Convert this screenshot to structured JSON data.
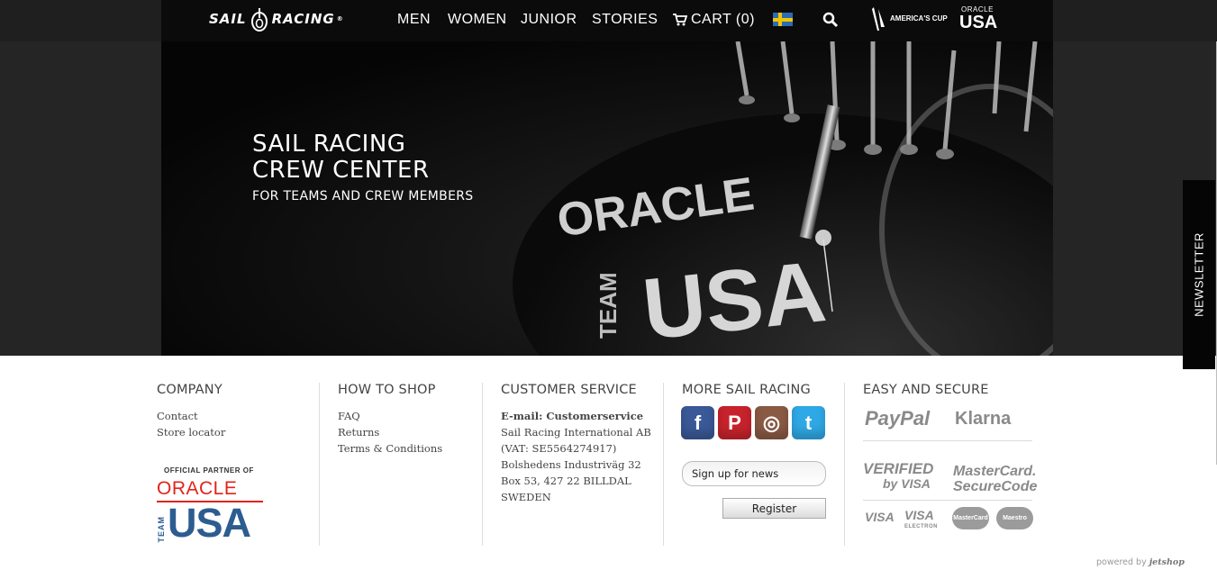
{
  "header": {
    "logo_text_left": "SAIL",
    "logo_text_right": "RACING",
    "logo_mark": "®",
    "nav": [
      "MEN",
      "WOMEN",
      "JUNIOR",
      "STORIES"
    ],
    "cart_label": "CART (0)",
    "flag": "sweden-flag",
    "partner_logo_1": "AMERICA'S CUP",
    "partner_logo_2_top": "ORACLE",
    "partner_logo_2_bottom": "USA"
  },
  "hero": {
    "title": "SAIL RACING\nCREW CENTER",
    "subtitle": "FOR TEAMS AND CREW MEMBERS",
    "embroidery_top": "ORACLE",
    "embroidery_team": "TEAM",
    "embroidery_usa": "USA"
  },
  "newsletter_tab": "NEWSLETTER",
  "footer": {
    "company": {
      "heading": "COMPANY",
      "links": [
        "Contact",
        "Store locator"
      ]
    },
    "partner": {
      "official": "OFFICIAL PARTNER OF",
      "oracle": "ORACLE",
      "team": "TEAM",
      "usa": "USA"
    },
    "how_to_shop": {
      "heading": "HOW TO SHOP",
      "links": [
        "FAQ",
        "Returns",
        "Terms & Conditions"
      ]
    },
    "customer_service": {
      "heading": "CUSTOMER SERVICE",
      "email": "E-mail: Customerservice",
      "lines": [
        "Sail Racing International AB",
        "(VAT: SE5564274917)",
        "Bolshedens Industriväg 32",
        "Box 53, 427 22 BILLDAL",
        "SWEDEN"
      ]
    },
    "more": {
      "heading": "MORE SAIL RACING",
      "social": [
        "f",
        "P",
        "◎",
        "t"
      ],
      "newsletter_value": "Sign up for news",
      "register_label": "Register"
    },
    "secure": {
      "heading": "EASY AND SECURE",
      "paypal": "PayPal",
      "klarna": "Klarna",
      "verified": "VERIFIED",
      "by_visa": "by VISA",
      "mastercard": "MasterCard.",
      "securecode": "SecureCode",
      "visa": "VISA",
      "visa_electron": "VISA",
      "electron": "ELECTRON",
      "mc_small": "MasterCard",
      "maestro": "Maestro"
    },
    "powered_by": "powered by",
    "powered_brand": "jetshop"
  },
  "colors": {
    "topbar": "#0b0b0b",
    "accent_red": "#e2231a",
    "usa_blue": "#2d5c91"
  }
}
